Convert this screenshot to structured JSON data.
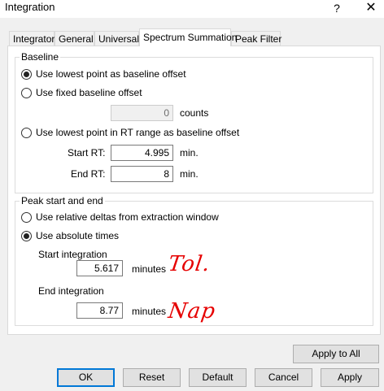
{
  "window": {
    "title": "Integration",
    "help_glyph": "?",
    "close_glyph": "✕"
  },
  "tabs": [
    {
      "label": "Integrator",
      "active": false
    },
    {
      "label": "General",
      "active": false
    },
    {
      "label": "Universal",
      "active": false
    },
    {
      "label": "Spectrum Summation",
      "active": true
    },
    {
      "label": "Peak Filter",
      "active": false
    }
  ],
  "baseline": {
    "legend": "Baseline",
    "opt_lowest_point": {
      "label": "Use lowest point as baseline offset",
      "checked": true
    },
    "opt_fixed": {
      "label": "Use fixed baseline offset",
      "checked": false
    },
    "fixed_value": "0",
    "fixed_unit": "counts",
    "opt_rt_range": {
      "label": "Use lowest point in RT range as baseline offset",
      "checked": false
    },
    "start_rt_label": "Start RT:",
    "start_rt_value": "4.995",
    "start_rt_unit": "min.",
    "end_rt_label": "End RT:",
    "end_rt_value": "8",
    "end_rt_unit": "min."
  },
  "peak": {
    "legend": "Peak start and end",
    "opt_relative": {
      "label": "Use relative deltas from extraction window",
      "checked": false
    },
    "opt_absolute": {
      "label": "Use absolute times",
      "checked": true
    },
    "start_label": "Start integration",
    "start_value": "5.617",
    "start_unit": "minutes",
    "end_label": "End integration",
    "end_value": "8.77",
    "end_unit": "minutes",
    "annotation_start": "Tol.",
    "annotation_end": "Nap",
    "annotation_color": "#e60000"
  },
  "buttons": {
    "apply_to_all": "Apply to All",
    "ok": "OK",
    "reset": "Reset",
    "default": "Default",
    "cancel": "Cancel",
    "apply": "Apply"
  }
}
